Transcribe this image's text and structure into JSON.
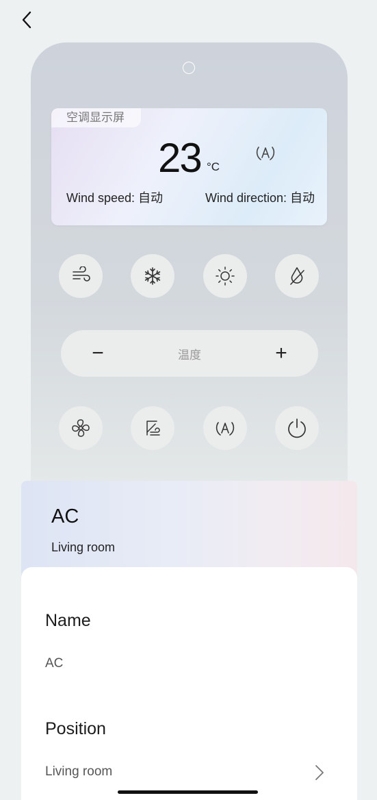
{
  "remote": {
    "display": {
      "tag": "空调显示屏",
      "temperature": "23",
      "unit": "°C",
      "wind_speed": "Wind speed: 自动",
      "wind_direction": "Wind direction: 自动"
    },
    "mode_buttons": [
      "wind-icon",
      "snowflake-icon",
      "sun-icon",
      "dry-icon"
    ],
    "temp_control": {
      "label": "温度",
      "minus": "−",
      "plus": "+"
    },
    "function_buttons": [
      "fan-icon",
      "swing-icon",
      "auto-mode-icon",
      "power-icon"
    ]
  },
  "device": {
    "name": "AC",
    "room": "Living room"
  },
  "settings": {
    "name_label": "Name",
    "name_value": "AC",
    "position_label": "Position",
    "position_value": "Living room"
  }
}
